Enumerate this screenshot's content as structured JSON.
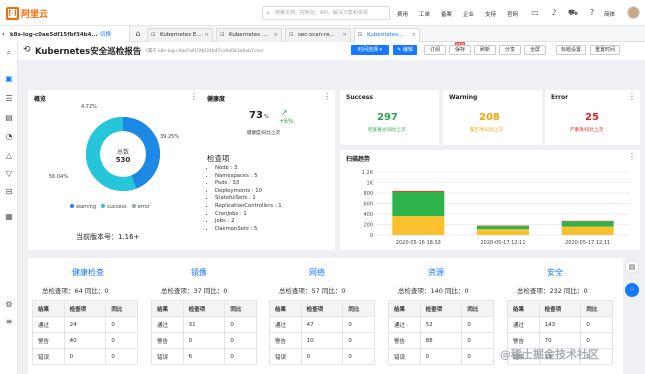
{
  "topbar": {
    "brand": "阿里云",
    "search_placeholder": "搜索文档、控制台、API、解决方案和资源",
    "nav": [
      "费用",
      "工单",
      "备案",
      "企业",
      "支持",
      "官网"
    ],
    "user": "简体"
  },
  "context": {
    "cluster": "k8s-log-c0ae5df15fbf34b4...",
    "switch": "切换"
  },
  "tabs": [
    {
      "label": "Kubernetes E...",
      "active": false
    },
    {
      "label": "Kubernetes ...",
      "active": false
    },
    {
      "label": "sec-scan-re...",
      "active": false
    },
    {
      "label": "Kubernetes...",
      "active": true
    }
  ],
  "page": {
    "title": "Kubernetes安全巡检报告",
    "id_text": "(属于 k8s-log-c0ae5df15fbf34b47ca0a083e6eb7cee)",
    "buttons": {
      "time": "时间选择 ▾",
      "edit": "✎ 编辑",
      "subscribe": "订阅",
      "save": "保存",
      "refresh": "刷新",
      "share": "分享",
      "fullscreen": "全屏",
      "title_settings": "标题设置",
      "reset_time": "重置时间"
    },
    "new_badge": "NEW"
  },
  "overview": {
    "title": "概览",
    "total_label": "总数",
    "total_value": "530",
    "pct_labels": {
      "warning": "4.72%",
      "success": "56.04%",
      "error": "39.25%"
    },
    "legend": [
      "warning",
      "success",
      "error"
    ],
    "version": "当前版本号：1.16+"
  },
  "health": {
    "title": "健康度",
    "value": "73",
    "unit": "%",
    "delta": "+6%",
    "sub": "健康度/同比上次",
    "items_title": "检查项",
    "items": [
      "Node : 3",
      "Namespaces : 5",
      "Pods : 33",
      "Deployments : 10",
      "StatefulSets : 1",
      "ReplicationControllers : 1",
      "CronJobs : 1",
      "Jobs : 2",
      "DaemonSets : 5"
    ]
  },
  "stats": [
    {
      "title": "Success",
      "value": "297",
      "sub": "检查通过/同比上次",
      "color": "#2ca44a"
    },
    {
      "title": "Warning",
      "value": "208",
      "sub": "警告项/同比上次",
      "color": "#f0a500"
    },
    {
      "title": "Error",
      "value": "25",
      "sub": "严重项/同比上次",
      "color": "#e02020"
    }
  ],
  "chart_data": {
    "type": "bar",
    "title": "扫描趋势",
    "categories": [
      "2020-05-16 18:33",
      "2020-05-17 12:11",
      "2020-05-17 12:11"
    ],
    "yticks": [
      "1.2K",
      "1K",
      "800",
      "600",
      "400",
      "200",
      "0"
    ],
    "ylim": [
      0,
      1200
    ],
    "series": [
      {
        "name": "warning",
        "color": "#fbc02d",
        "values": [
          360,
          110,
          160
        ]
      },
      {
        "name": "success",
        "color": "#2cb34a",
        "values": [
          460,
          60,
          100
        ]
      },
      {
        "name": "error",
        "color": "#e53935",
        "values": [
          20,
          10,
          10
        ]
      }
    ]
  },
  "categories": [
    {
      "name": "健康检查",
      "total": "总检查项：64 同比：0",
      "rows": [
        [
          "通过",
          "24",
          "0"
        ],
        [
          "警告",
          "40",
          "0"
        ],
        [
          "错误",
          "0",
          "0"
        ]
      ]
    },
    {
      "name": "镜像",
      "total": "总检查项：37 同比：0",
      "rows": [
        [
          "通过",
          "31",
          "0"
        ],
        [
          "警告",
          "0",
          "0"
        ],
        [
          "错误",
          "6",
          "0"
        ]
      ]
    },
    {
      "name": "网络",
      "total": "总检查项：57 同比：0",
      "rows": [
        [
          "通过",
          "47",
          "0"
        ],
        [
          "警告",
          "10",
          "0"
        ],
        [
          "错误",
          "0",
          "0"
        ]
      ]
    },
    {
      "name": "资源",
      "total": "总检查项：140 同比：0",
      "rows": [
        [
          "通过",
          "52",
          "0"
        ],
        [
          "警告",
          "88",
          "0"
        ],
        [
          "错误",
          "0",
          "0"
        ]
      ]
    },
    {
      "name": "安全",
      "total": "总检查项：232 同比：0",
      "rows": [
        [
          "通过",
          "143",
          "0"
        ],
        [
          "警告",
          "70",
          "0"
        ],
        [
          "错误",
          "19",
          "0"
        ]
      ]
    }
  ],
  "table_headers": [
    "结果",
    "检查项",
    "同比"
  ],
  "watermark": "@稀土掘金技术社区"
}
